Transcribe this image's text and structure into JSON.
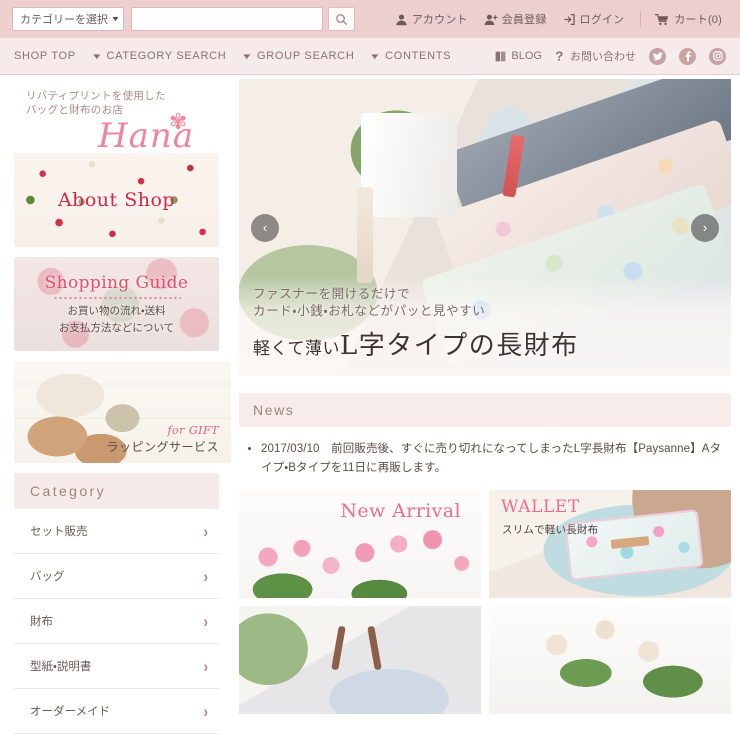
{
  "topbar": {
    "category_select": {
      "value": "カテゴリーを選択"
    },
    "search": {
      "value": "",
      "placeholder": ""
    },
    "search_button_icon": "search-icon",
    "links": [
      {
        "label": "アカウント",
        "icon": "account-icon"
      },
      {
        "label": "会員登録",
        "icon": "user-add-icon"
      },
      {
        "label": "ログイン",
        "icon": "login-icon"
      },
      {
        "label": "カート(0)",
        "icon": "cart-icon"
      }
    ]
  },
  "nav": {
    "items": [
      {
        "label": "SHOP TOP",
        "has_chevron": false
      },
      {
        "label": "CATEGORY SEARCH",
        "has_chevron": true
      },
      {
        "label": "GROUP SEARCH",
        "has_chevron": true
      },
      {
        "label": "CONTENTS",
        "has_chevron": true
      }
    ],
    "right": [
      {
        "label": "BLOG",
        "icon": "book-icon"
      },
      {
        "label": "お問い合わせ",
        "icon": "question-icon"
      }
    ],
    "social": [
      {
        "name": "twitter-icon",
        "glyph": "t"
      },
      {
        "name": "facebook-icon",
        "glyph": "f"
      },
      {
        "name": "instagram-icon",
        "glyph": "◉"
      }
    ]
  },
  "logo": {
    "tagline_line1": "リバティプリントを使用した",
    "tagline_line2": "バッグと財布のお店",
    "name": "Hana",
    "flower_icon": "flower-icon"
  },
  "sidebar": {
    "banners": [
      {
        "title": "About Shop",
        "sub": "",
        "kicker": ""
      },
      {
        "title": "Shopping Guide",
        "sub_line1": "お買い物の流れ・送料",
        "sub_line2": "お支払方法などについて"
      },
      {
        "kicker": "for GIFT",
        "sub": "ラッピングサービス"
      }
    ],
    "category": {
      "heading": "Category",
      "items": [
        {
          "label": "セット販売"
        },
        {
          "label": "バッグ"
        },
        {
          "label": "財布"
        },
        {
          "label": "型紙・説明書"
        },
        {
          "label": "オーダーメイド"
        }
      ]
    }
  },
  "hero": {
    "caption_sub_line1": "ファスナーを開けるだけで",
    "caption_sub_line2": "カード・小銭・お札などがパッと見やすい",
    "caption_main_small": "軽くて薄い",
    "caption_main": "L字タイプの長財布",
    "prev_label": "‹",
    "next_label": "›"
  },
  "news": {
    "heading": "News",
    "items": [
      "2017/03/10　前回販売後、すぐに売り切れになってしまったL字長財布【Paysanne】Aタイプ・Bタイプを11日に再販します。"
    ]
  },
  "products": [
    {
      "title": "New Arrival",
      "sub": ""
    },
    {
      "title": "WALLET",
      "sub": "スリムで軽い長財布"
    },
    {
      "title": "",
      "sub": ""
    },
    {
      "title": "",
      "sub": ""
    }
  ],
  "colors": {
    "topbar_bg": "#eecfd0",
    "nav_bg": "#f6eaea",
    "accent_pink": "#f0849a",
    "heading_text": "#9b8482",
    "band_bg": "#f7ebe9"
  }
}
